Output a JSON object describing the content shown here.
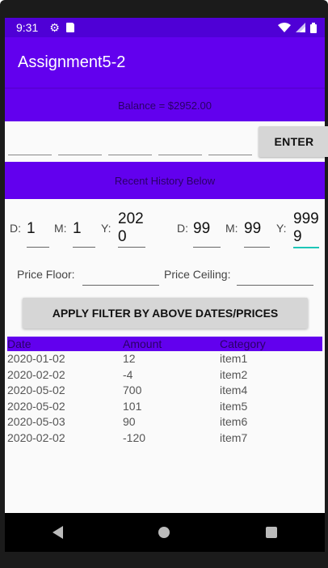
{
  "status_bar": {
    "time": "9:31",
    "icons": [
      "gear-icon",
      "sd-card-icon",
      "wifi-icon",
      "signal-icon",
      "battery-icon"
    ]
  },
  "app_bar": {
    "title": "Assignment5-2"
  },
  "balance": {
    "text": "Balance = $2952.00"
  },
  "entry": {
    "fields": [
      "",
      "",
      "",
      "",
      ""
    ],
    "enter_label": "ENTER"
  },
  "history": {
    "text": "Recent History Below"
  },
  "date_filter": {
    "from": {
      "d_label": "D:",
      "d": "1",
      "m_label": "M:",
      "m": "1",
      "y_label": "Y:",
      "y": "202\n0"
    },
    "to": {
      "d_label": "D:",
      "d": "99",
      "m_label": "M:",
      "m": "99",
      "y_label": "Y:",
      "y": "999\n9"
    }
  },
  "price_filter": {
    "floor_label": "Price Floor:",
    "floor_value": "",
    "ceiling_label": "Price Ceiling:",
    "ceiling_value": ""
  },
  "apply_label": "APPLY FILTER BY ABOVE DATES/PRICES",
  "table": {
    "headers": [
      "Date",
      "Amount",
      "Category"
    ],
    "rows": [
      [
        "2020-01-02",
        "12",
        "item1"
      ],
      [
        "2020-02-02",
        "-4",
        "item2"
      ],
      [
        "2020-05-02",
        "700",
        "item4"
      ],
      [
        "2020-05-02",
        "101",
        "item5"
      ],
      [
        "2020-05-03",
        "90",
        "item6"
      ],
      [
        "2020-02-02",
        "-120",
        "item7"
      ]
    ]
  },
  "colors": {
    "primary": "#6200ee",
    "primary_dark": "#4f00d6",
    "accent": "#1ec6b8"
  }
}
